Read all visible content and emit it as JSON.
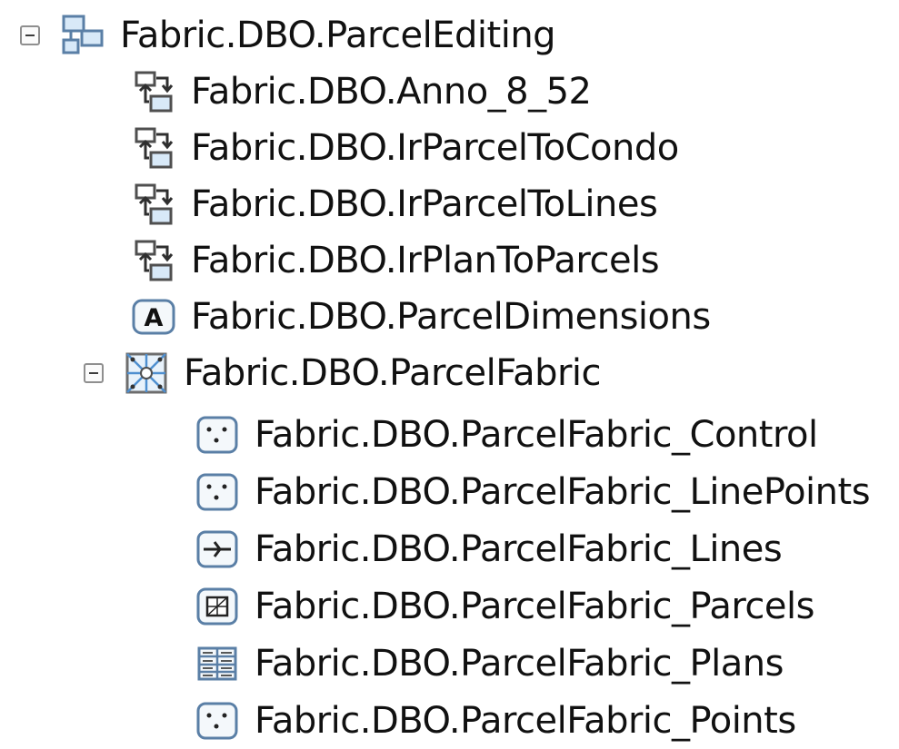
{
  "tree": {
    "root": {
      "label": "Fabric.DBO.ParcelEditing",
      "icon": "feature-dataset-icon",
      "expanded": true
    },
    "children": [
      {
        "label": "Fabric.DBO.Anno_8_52",
        "icon": "relationship-class-icon"
      },
      {
        "label": "Fabric.DBO.IrParcelToCondo",
        "icon": "relationship-class-icon"
      },
      {
        "label": "Fabric.DBO.IrParcelToLines",
        "icon": "relationship-class-icon"
      },
      {
        "label": "Fabric.DBO.IrPlanToParcels",
        "icon": "relationship-class-icon"
      },
      {
        "label": "Fabric.DBO.ParcelDimensions",
        "icon": "annotation-class-icon",
        "icon_text": "A"
      },
      {
        "label": "Fabric.DBO.ParcelFabric",
        "icon": "parcel-fabric-icon",
        "expanded": true
      }
    ],
    "fabric_children": [
      {
        "label": "Fabric.DBO.ParcelFabric_Control",
        "icon": "point-feature-class-icon"
      },
      {
        "label": "Fabric.DBO.ParcelFabric_LinePoints",
        "icon": "point-feature-class-icon"
      },
      {
        "label": "Fabric.DBO.ParcelFabric_Lines",
        "icon": "line-feature-class-icon"
      },
      {
        "label": "Fabric.DBO.ParcelFabric_Parcels",
        "icon": "polygon-feature-class-icon"
      },
      {
        "label": "Fabric.DBO.ParcelFabric_Plans",
        "icon": "table-icon"
      },
      {
        "label": "Fabric.DBO.ParcelFabric_Points",
        "icon": "point-feature-class-icon"
      }
    ]
  }
}
